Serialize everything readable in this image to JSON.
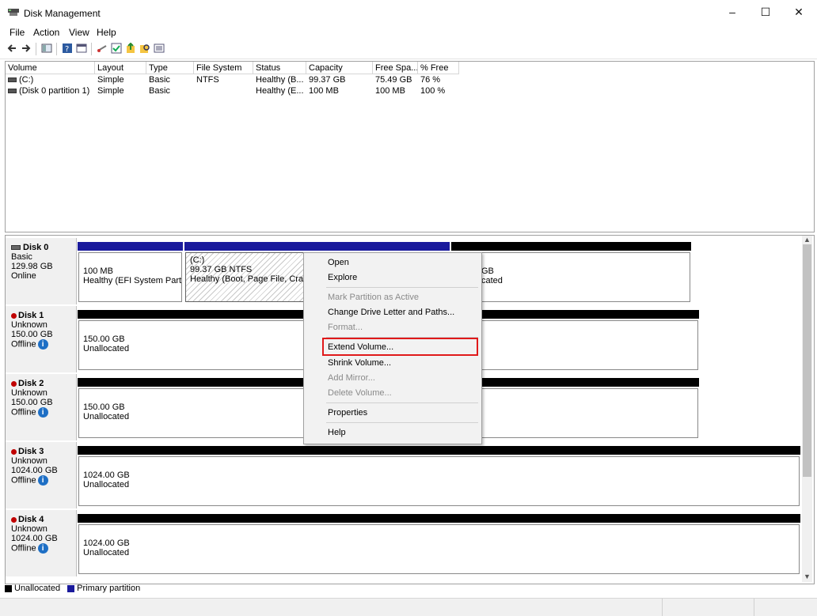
{
  "window": {
    "title": "Disk Management",
    "controls": [
      "–",
      "☐",
      "✕"
    ]
  },
  "menu": [
    "File",
    "Action",
    "View",
    "Help"
  ],
  "toolbar": [
    "back-icon",
    "forward-icon",
    "console-tree-icon",
    "help-icon",
    "properties-icon",
    "connect-icon",
    "check-icon",
    "up-icon",
    "search-icon",
    "list-icon"
  ],
  "volume_list": {
    "columns": [
      "Volume",
      "Layout",
      "Type",
      "File System",
      "Status",
      "Capacity",
      "Free Spa...",
      "% Free"
    ],
    "rows": [
      {
        "volume": "(C:)",
        "layout": "Simple",
        "type": "Basic",
        "fs": "NTFS",
        "status": "Healthy (B...",
        "capacity": "99.37 GB",
        "free": "75.49 GB",
        "pct": "76 %"
      },
      {
        "volume": "(Disk 0 partition 1)",
        "layout": "Simple",
        "type": "Basic",
        "fs": "",
        "status": "Healthy (E...",
        "capacity": "100 MB",
        "free": "100 MB",
        "pct": "100 %"
      }
    ]
  },
  "disks": [
    {
      "name": "Disk 0",
      "type": "Basic",
      "size": "129.98 GB",
      "state": "Online"
    },
    {
      "name": "Disk 1",
      "type": "Unknown",
      "size": "150.00 GB",
      "state": "Offline"
    },
    {
      "name": "Disk 2",
      "type": "Unknown",
      "size": "150.00 GB",
      "state": "Offline"
    },
    {
      "name": "Disk 3",
      "type": "Unknown",
      "size": "1024.00 GB",
      "state": "Offline"
    },
    {
      "name": "Disk 4",
      "type": "Unknown",
      "size": "1024.00 GB",
      "state": "Offline"
    }
  ],
  "partitions": {
    "d0p1": {
      "size": "100 MB",
      "status": "Healthy (EFI System Partiti"
    },
    "d0p2": {
      "label": "(C:)",
      "size": "99.37 GB NTFS",
      "status": "Healthy (Boot, Page File, Crash"
    },
    "d0p3": {
      "size": "GB",
      "status": "cated"
    },
    "d1": {
      "size": "150.00 GB",
      "status": "Unallocated"
    },
    "d2": {
      "size": "150.00 GB",
      "status": "Unallocated"
    },
    "d3": {
      "size": "1024.00 GB",
      "status": "Unallocated"
    },
    "d4": {
      "size": "1024.00 GB",
      "status": "Unallocated"
    }
  },
  "context_menu": {
    "items": [
      {
        "label": "Open",
        "enabled": true
      },
      {
        "label": "Explore",
        "enabled": true
      },
      {
        "label": "Mark Partition as Active",
        "enabled": false
      },
      {
        "label": "Change Drive Letter and Paths...",
        "enabled": true
      },
      {
        "label": "Format...",
        "enabled": false
      },
      {
        "label": "Extend Volume...",
        "enabled": true
      },
      {
        "label": "Shrink Volume...",
        "enabled": true
      },
      {
        "label": "Add Mirror...",
        "enabled": false
      },
      {
        "label": "Delete Volume...",
        "enabled": false
      },
      {
        "label": "Properties",
        "enabled": true
      },
      {
        "label": "Help",
        "enabled": true
      }
    ]
  },
  "legend": {
    "unallocated": "Unallocated",
    "primary": "Primary partition"
  },
  "colors": {
    "primary": "#1a1a9c",
    "unallocated": "#000000",
    "highlight": "#e0191a"
  }
}
